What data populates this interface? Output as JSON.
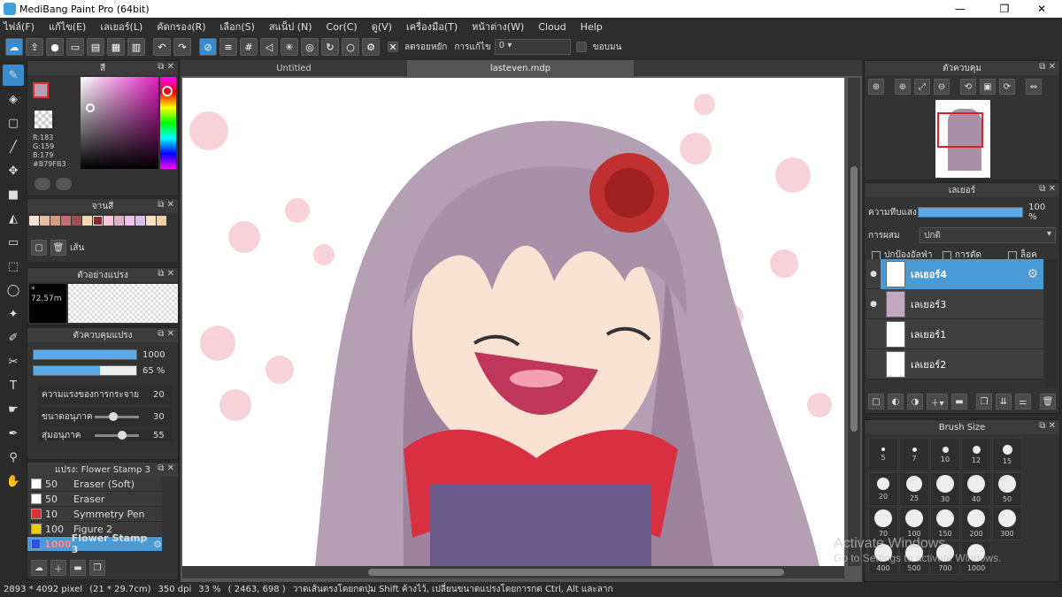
{
  "window": {
    "title": "MediBang Paint Pro (64bit)",
    "min": "—",
    "max": "❐",
    "close": "✕"
  },
  "menu": [
    "ไฟล์(F)",
    "แก้ไข(E)",
    "เลเยอร์(L)",
    "คัดกรอง(R)",
    "เลือก(S)",
    "สแน็ป (N)",
    "Cor(C)",
    "ดู(V)",
    "เครื่องมือ(T)",
    "หน้าต่าง(W)",
    "Cloud",
    "Help"
  ],
  "toolbar": {
    "antialias": "ลดรอยหยัก",
    "correction_label": "การแก้ไข",
    "correction_value": "0",
    "edge": "ขอบมน"
  },
  "tabs": [
    "Untitled",
    "lasteven.mdp"
  ],
  "color_panel": {
    "title": "สี",
    "r": "R:183",
    "g": "G:159",
    "b": "B:179",
    "hex": "#B79FB3"
  },
  "palette_panel": {
    "title": "จานสี",
    "line": "เส้น"
  },
  "brush_preview": {
    "title": "ตัวอย่างแปรง",
    "value": "* 72.57m"
  },
  "brush_control": {
    "title": "ตัวควบคุมแปรง",
    "size": "1000",
    "opacity": "65 %",
    "opacity_val": 0.65,
    "scatter_label": "ความแรงของการกระจาย",
    "scatter": "20",
    "particle_label": "ขนาดอนุภาค",
    "particle": "30",
    "random_label": "สุ่มอนุภาค",
    "random": "55"
  },
  "brush_list": {
    "title": "แปรง: Flower Stamp 3",
    "items": [
      {
        "size": "50",
        "name": "Eraser (Soft)",
        "color": "#ffffff"
      },
      {
        "size": "50",
        "name": "Eraser",
        "color": "#ffffff"
      },
      {
        "size": "10",
        "name": "Symmetry Pen",
        "color": "#e03030"
      },
      {
        "size": "100",
        "name": "Figure 2",
        "color": "#e8d000"
      },
      {
        "size": "1000",
        "name": "Flower Stamp 3",
        "color": "#3050e0"
      }
    ]
  },
  "navigator": {
    "title": "ตัวควบคุม"
  },
  "layer_panel": {
    "title": "เลเยอร์",
    "opacity_label": "ความทึบแสง",
    "opacity": "100 %",
    "blend_label": "การผสม",
    "blend": "ปกติ",
    "protect": "ปกป้องอัลฟ่า",
    "clip": "การตัด",
    "lock": "ล็อค",
    "layers": [
      "เลเยอร์4",
      "เลเยอร์3",
      "เลเยอร์1",
      "เลเยอร์2"
    ]
  },
  "brush_size": {
    "title": "Brush Size",
    "sizes": [
      "5",
      "7",
      "10",
      "12",
      "15",
      "20",
      "25",
      "30",
      "40",
      "50",
      "70",
      "100",
      "150",
      "200",
      "300",
      "400",
      "500",
      "700",
      "1000"
    ]
  },
  "status": {
    "dims": "2893 * 4092 pixel",
    "cm": "(21 * 29.7cm)",
    "dpi": "350 dpi",
    "zoom": "33 %",
    "coords": "( 2463, 698 )",
    "hint": "วาดเส้นตรงโดยกดปุ่ม Shift ค้างไว้, เปลี่ยนขนาดแปรงโดยการกด Ctrl, Alt และลาก"
  },
  "watermark": {
    "line1": "Activate Windows",
    "line2": "Go to Settings to activate Windows."
  }
}
